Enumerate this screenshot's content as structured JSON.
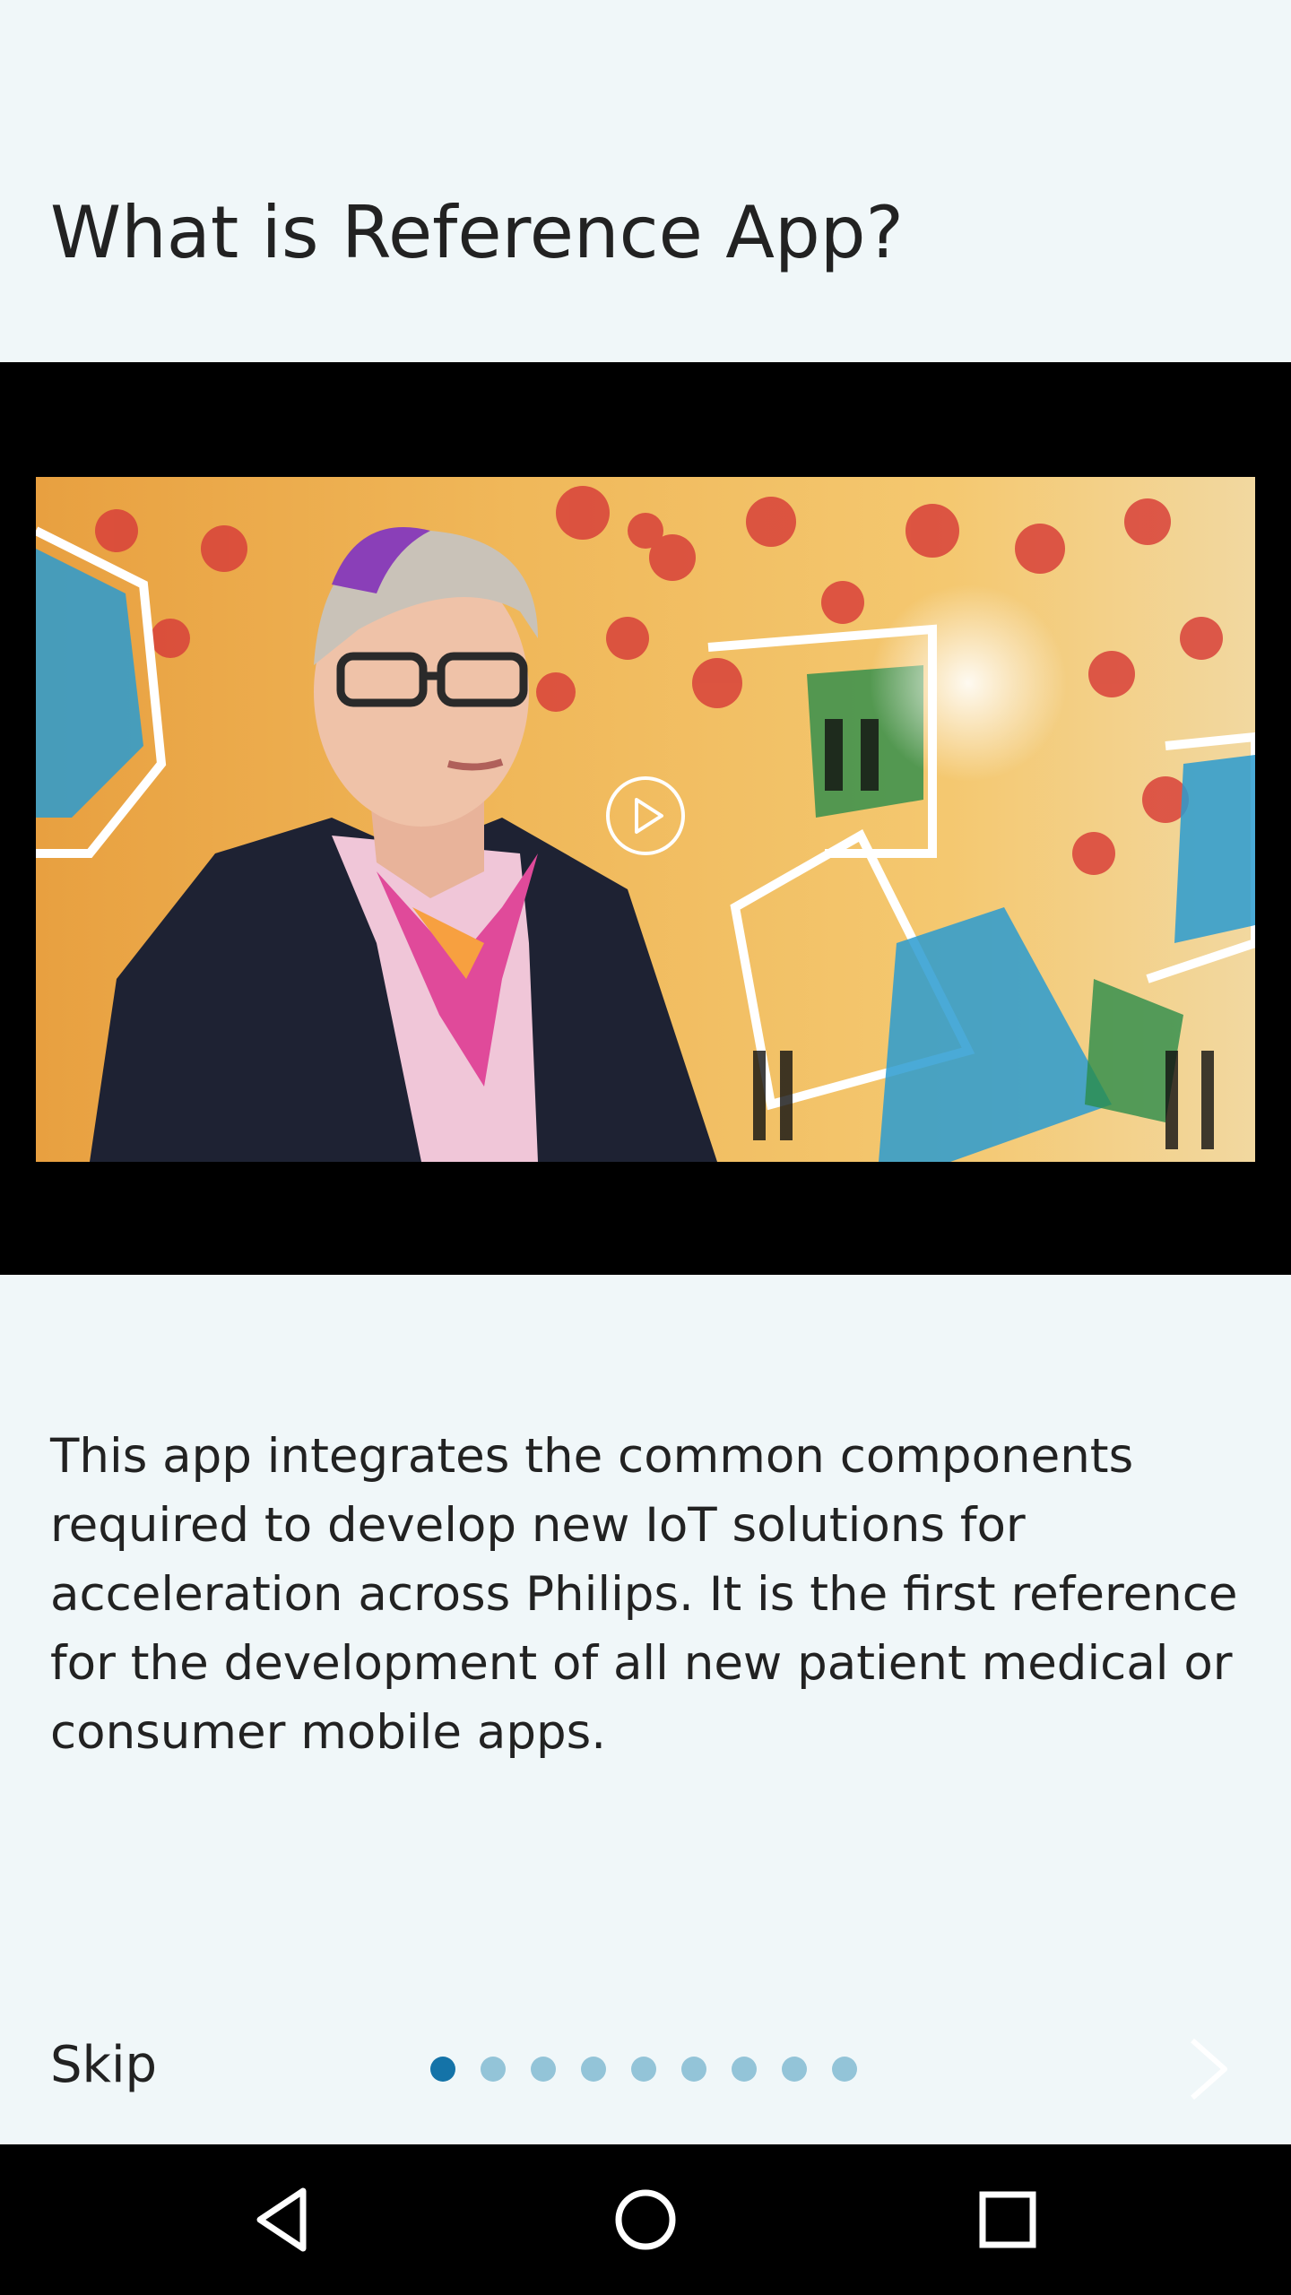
{
  "onboarding": {
    "title": "What is Reference App?",
    "description": "This app integrates the common components required to develop new IoT solutions for acceleration across Philips. It is the first reference for the development of all new patient medical or consumer mobile apps.",
    "skip_label": "Skip",
    "page_count": 9,
    "current_page": 1,
    "video": {
      "play_icon": "play-circle-icon"
    },
    "next_icon": "chevron-right-icon"
  },
  "navigation_bar": {
    "back_icon": "back-triangle-icon",
    "home_icon": "home-circle-icon",
    "recents_icon": "recents-square-icon"
  },
  "colors": {
    "background": "#f0f7f9",
    "active_dot": "#1473a8",
    "inactive_dot": "#93c4d8",
    "text": "#222222"
  }
}
